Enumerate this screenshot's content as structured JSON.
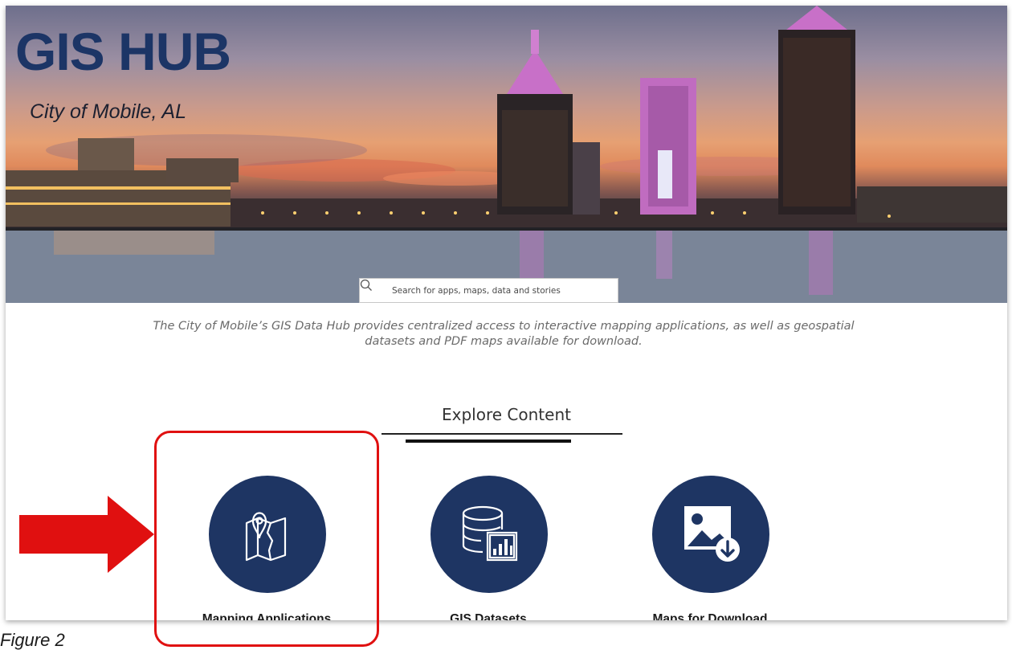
{
  "hero": {
    "title": "GIS HUB",
    "subtitle": "City of Mobile, AL"
  },
  "search": {
    "placeholder": "Search for apps, maps, data and stories"
  },
  "intro": {
    "text": "The City of Mobile’s GIS Data Hub provides centralized access to interactive mapping applications, as well as geospatial datasets and PDF maps available for download."
  },
  "explore": {
    "heading": "Explore Content",
    "tiles": [
      {
        "label": "Mapping Applications",
        "icon": "map-pin-icon"
      },
      {
        "label": "GIS Datasets",
        "icon": "database-chart-icon"
      },
      {
        "label": "Maps for Download",
        "icon": "image-download-icon"
      }
    ]
  },
  "caption": {
    "text": "Figure 2"
  },
  "colors": {
    "brand_navy": "#1e3563",
    "title_navy": "#1c3566",
    "annotation_red": "#e01010"
  }
}
